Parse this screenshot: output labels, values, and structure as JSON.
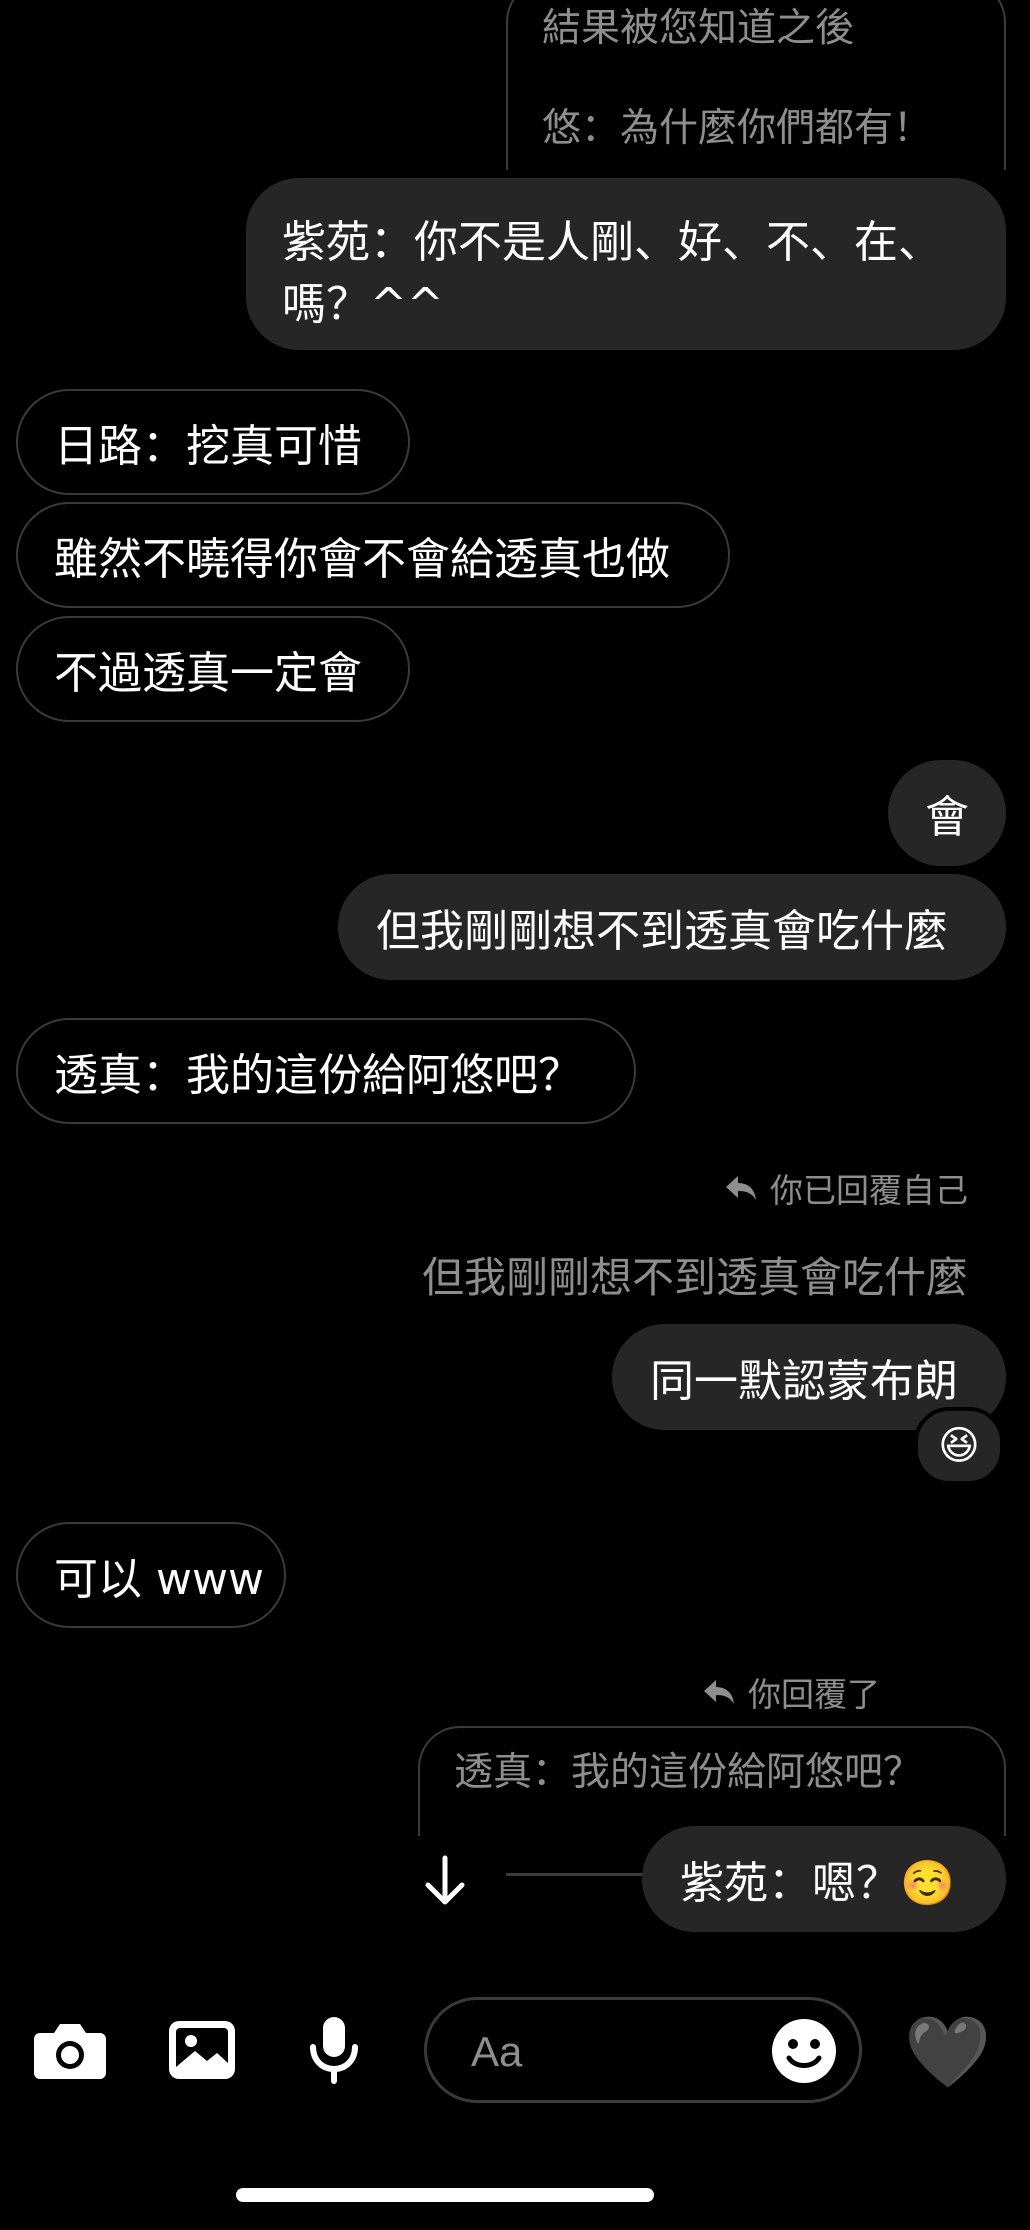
{
  "messages": {
    "quote_top": {
      "line1": "結果被您知道之後",
      "line2": "悠：為什麼你們都有！"
    },
    "sent_1": {
      "line1": "紫苑：你不是人剛、好、不、在、",
      "line2": "嗎？^^"
    },
    "recv_1": "日路：挖真可惜",
    "recv_2": "雖然不曉得你會不會給透真也做",
    "recv_3": "不過透真一定會",
    "sent_2": "會",
    "sent_3": "但我剛剛想不到透真會吃什麼",
    "recv_4": "透真：我的這份給阿悠吧？",
    "reply_label_1": "你已回覆自己",
    "reply_quote_1": "但我剛剛想不到透真會吃什麼",
    "sent_4": "同一默認蒙布朗",
    "reaction_1": "😆",
    "recv_5": "可以 www",
    "reply_label_2": "你回覆了",
    "reply_quote_2": "透真：我的這份給阿悠吧？",
    "sent_5": "紫苑：嗯？☺️"
  },
  "composer": {
    "placeholder": "Aa",
    "like_emoji": "🖤"
  },
  "icons": {
    "camera": "camera-icon",
    "gallery": "gallery-icon",
    "microphone": "microphone-icon",
    "sticker": "sticker-icon",
    "scroll_down": "arrow-down-icon",
    "reply": "reply-arrow-icon"
  },
  "colors": {
    "background": "#000000",
    "sent_bubble": "#262626",
    "outline": "#3a3a3a",
    "muted_text": "#8e8e8e"
  }
}
